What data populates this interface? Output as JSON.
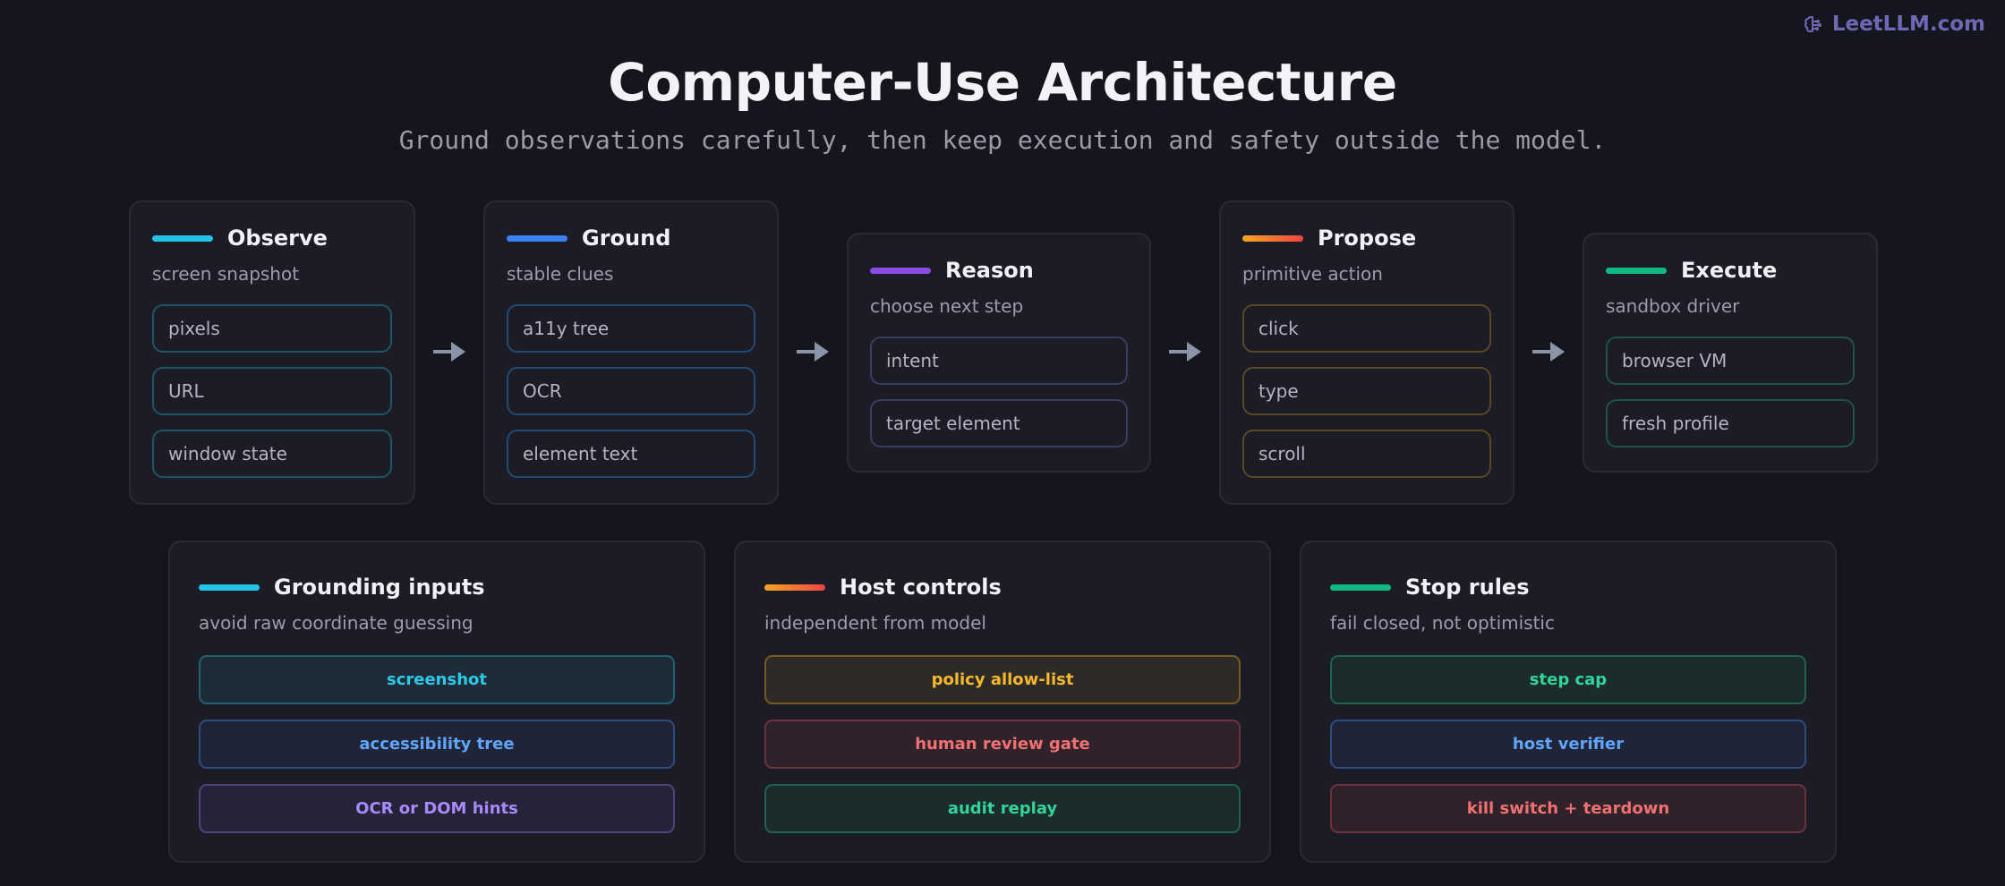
{
  "brand": {
    "name": "LeetLLM.com",
    "icon": "brain-icon"
  },
  "title": "Computer-Use Architecture",
  "subtitle": "Ground observations carefully, then keep execution and safety outside the model.",
  "colors": {
    "cyan": "#22c3e6",
    "blue": "#3b82f6",
    "purple": "#8b4ce6",
    "orange": "#f59e1a",
    "green": "#10b981",
    "red": "#f05a5a"
  },
  "steps": [
    {
      "title": "Observe",
      "subtitle": "screen snapshot",
      "chips": [
        "pixels",
        "URL",
        "window state"
      ]
    },
    {
      "title": "Ground",
      "subtitle": "stable clues",
      "chips": [
        "a11y tree",
        "OCR",
        "element text"
      ]
    },
    {
      "title": "Reason",
      "subtitle": "choose next step",
      "chips": [
        "intent",
        "target element"
      ]
    },
    {
      "title": "Propose",
      "subtitle": "primitive action",
      "chips": [
        "click",
        "type",
        "scroll"
      ]
    },
    {
      "title": "Execute",
      "subtitle": "sandbox driver",
      "chips": [
        "browser VM",
        "fresh profile"
      ]
    }
  ],
  "panels": [
    {
      "title": "Grounding inputs",
      "subtitle": "avoid raw coordinate guessing",
      "items": [
        "screenshot",
        "accessibility tree",
        "OCR or DOM hints"
      ]
    },
    {
      "title": "Host controls",
      "subtitle": "independent from model",
      "items": [
        "policy allow-list",
        "human review gate",
        "audit replay"
      ]
    },
    {
      "title": "Stop rules",
      "subtitle": "fail closed, not optimistic",
      "items": [
        "step cap",
        "host verifier",
        "kill switch + teardown"
      ]
    }
  ]
}
